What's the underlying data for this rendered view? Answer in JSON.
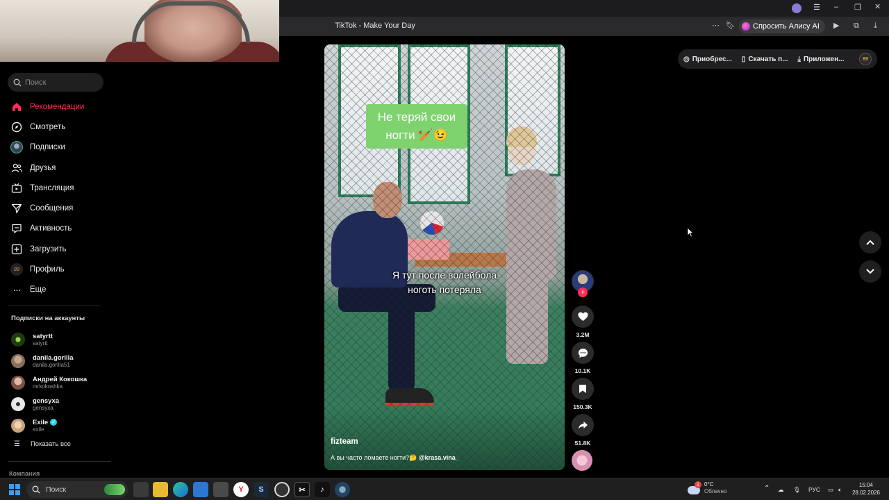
{
  "browser": {
    "tab_title": "TikTok - Make Your Day",
    "alice_button": "Спросить Алису AI"
  },
  "sidebar": {
    "search_placeholder": "Поиск",
    "nav": [
      {
        "label": "Рекомендации",
        "icon": "home-icon",
        "active": true
      },
      {
        "label": "Смотреть",
        "icon": "compass-icon"
      },
      {
        "label": "Подписки",
        "icon": "avatar-icon"
      },
      {
        "label": "Друзья",
        "icon": "friends-icon"
      },
      {
        "label": "Трансляция",
        "icon": "live-tv-icon"
      },
      {
        "label": "Сообщения",
        "icon": "paper-plane-icon"
      },
      {
        "label": "Активность",
        "icon": "activity-icon"
      },
      {
        "label": "Загрузить",
        "icon": "upload-plus-icon"
      },
      {
        "label": "Профиль",
        "icon": "profile-icon"
      },
      {
        "label": "Еще",
        "icon": "more-dots-icon"
      }
    ],
    "profile_badge": "89",
    "subscriptions_title": "Подписки на аккаунты",
    "subscriptions": [
      {
        "name": "satyrtt",
        "handle": "satyrtt",
        "color": "#1e3a12"
      },
      {
        "name": "danila.gorilla",
        "handle": "danila.gorilla51",
        "color": "#8a6f5c"
      },
      {
        "name": "Андрей Кокошка",
        "handle": "mrkokoshka",
        "color": "#7a5248"
      },
      {
        "name": "gensyxa",
        "handle": "gensyxa",
        "color": "#e9e9e9"
      },
      {
        "name": "Exile",
        "handle": "exile",
        "color": "#c9a47e",
        "verified": true
      }
    ],
    "show_all": "Показать все",
    "company": "Компания"
  },
  "video": {
    "sticker_line1": "Не теряй свои",
    "sticker_line2": "ногти 🏏😉",
    "caption_line1": "Я тут после волейбола",
    "caption_line2": "ноготь потеряла",
    "author": "fizteam",
    "description": "А вы часто ломаете ногти?🤔 ",
    "mention": "@krasa.vina_"
  },
  "actions": {
    "likes": "3.2M",
    "comments": "10.1K",
    "saves": "150.3K",
    "shares": "51.8K"
  },
  "top_pills": {
    "coins": "Приобрес...",
    "download": "Скачать п...",
    "app": "Приложен...",
    "profile_badge": "89"
  },
  "taskbar": {
    "search": "Поиск",
    "temperature": "0°C",
    "weather": "Облачно",
    "weather_badge": "1",
    "language": "РУС",
    "time": "15:04",
    "date": "28.02.2026"
  },
  "colors": {
    "accent": "#fe2c55",
    "sticker_bg": "#7fd36e",
    "verified": "#20d5ec"
  }
}
